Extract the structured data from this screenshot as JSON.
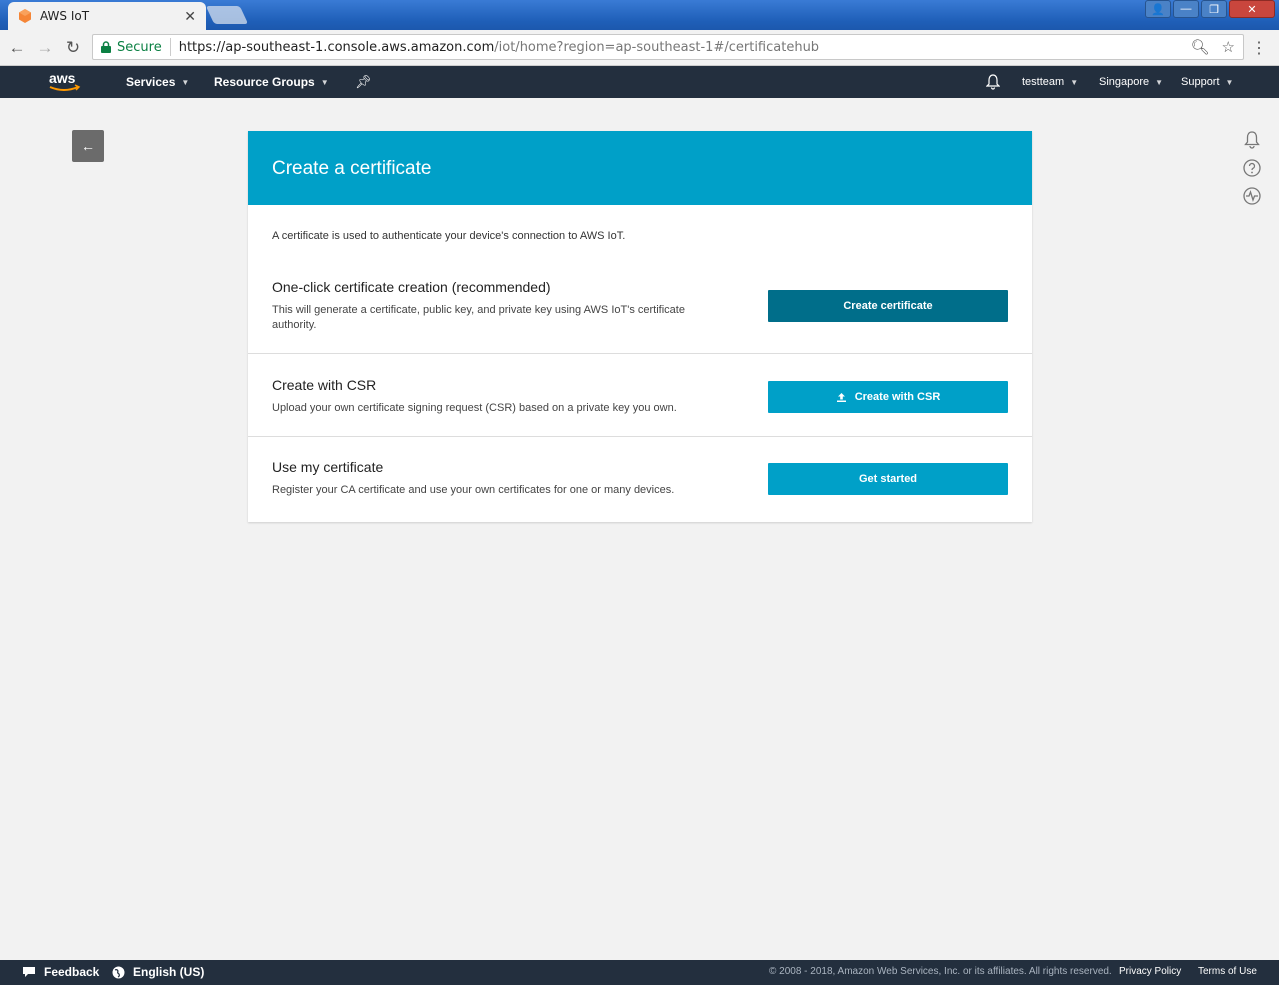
{
  "browser": {
    "tab_title": "AWS IoT",
    "tab_close": "✕",
    "secure_label": "Secure",
    "url_host": "https://ap-southeast-1.console.aws.amazon.com",
    "url_path": "/iot/home?region=ap-southeast-1#/certificatehub"
  },
  "aws_nav": {
    "logo": "aws",
    "services": "Services",
    "resource_groups": "Resource Groups",
    "account": "testteam",
    "region": "Singapore",
    "support": "Support"
  },
  "card": {
    "title": "Create a certificate",
    "intro": "A certificate is used to authenticate your device's connection to AWS IoT.",
    "sections": [
      {
        "title": "One-click certificate creation (recommended)",
        "description": "This will generate a certificate, public key, and private key using AWS IoT's certificate authority.",
        "button": "Create certificate"
      },
      {
        "title": "Create with CSR",
        "description": "Upload your own certificate signing request (CSR) based on a private key you own.",
        "button": "Create with CSR"
      },
      {
        "title": "Use my certificate",
        "description": "Register your CA certificate and use your own certificates for one or many devices.",
        "button": "Get started"
      }
    ]
  },
  "footer": {
    "feedback": "Feedback",
    "language": "English (US)",
    "copyright": "© 2008 - 2018, Amazon Web Services, Inc. or its affiliates. All rights reserved.",
    "privacy": "Privacy Policy",
    "terms": "Terms of Use"
  },
  "colors": {
    "header_bar": "#232f3e",
    "card_header": "#00a0c8",
    "primary_button": "#006e8a",
    "secondary_button": "#00a0c8",
    "secure_green": "#0b8043"
  }
}
